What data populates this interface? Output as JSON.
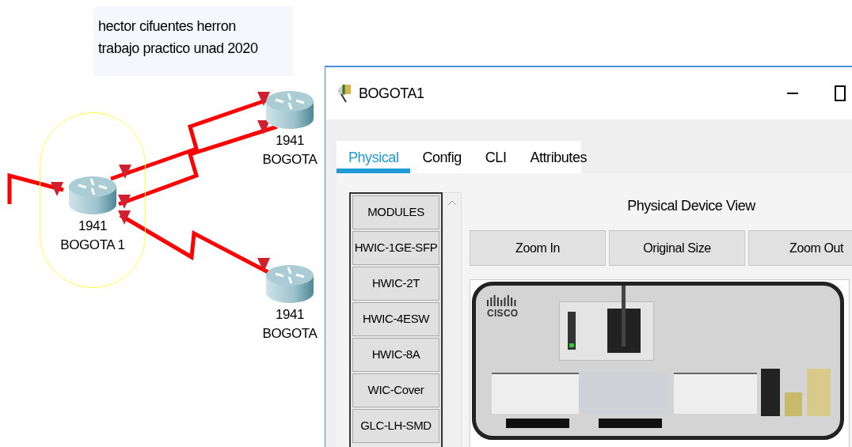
{
  "canvas": {
    "note": [
      "hector cifuentes herron",
      "trabajo practico unad 2020"
    ],
    "devices": [
      {
        "model": "1941",
        "name": "BOGOTA 1",
        "selected": true
      },
      {
        "model": "1941",
        "name": "BOGOTA",
        "selected": false
      },
      {
        "model": "1941",
        "name": "BOGOTA",
        "selected": false
      }
    ]
  },
  "window": {
    "title": "BOGOTA1",
    "tabs": [
      {
        "label": "Physical",
        "selected": true
      },
      {
        "label": "Config",
        "selected": false
      },
      {
        "label": "CLI",
        "selected": false
      },
      {
        "label": "Attributes",
        "selected": false
      }
    ],
    "modules": [
      "MODULES",
      "HWIC-1GE-SFP",
      "HWIC-2T",
      "HWIC-4ESW",
      "HWIC-8A",
      "WIC-Cover",
      "GLC-LH-SMD"
    ],
    "view_title": "Physical Device View",
    "buttons": [
      "Zoom In",
      "Original Size",
      "Zoom Out"
    ],
    "device_logo": "CISCO"
  }
}
